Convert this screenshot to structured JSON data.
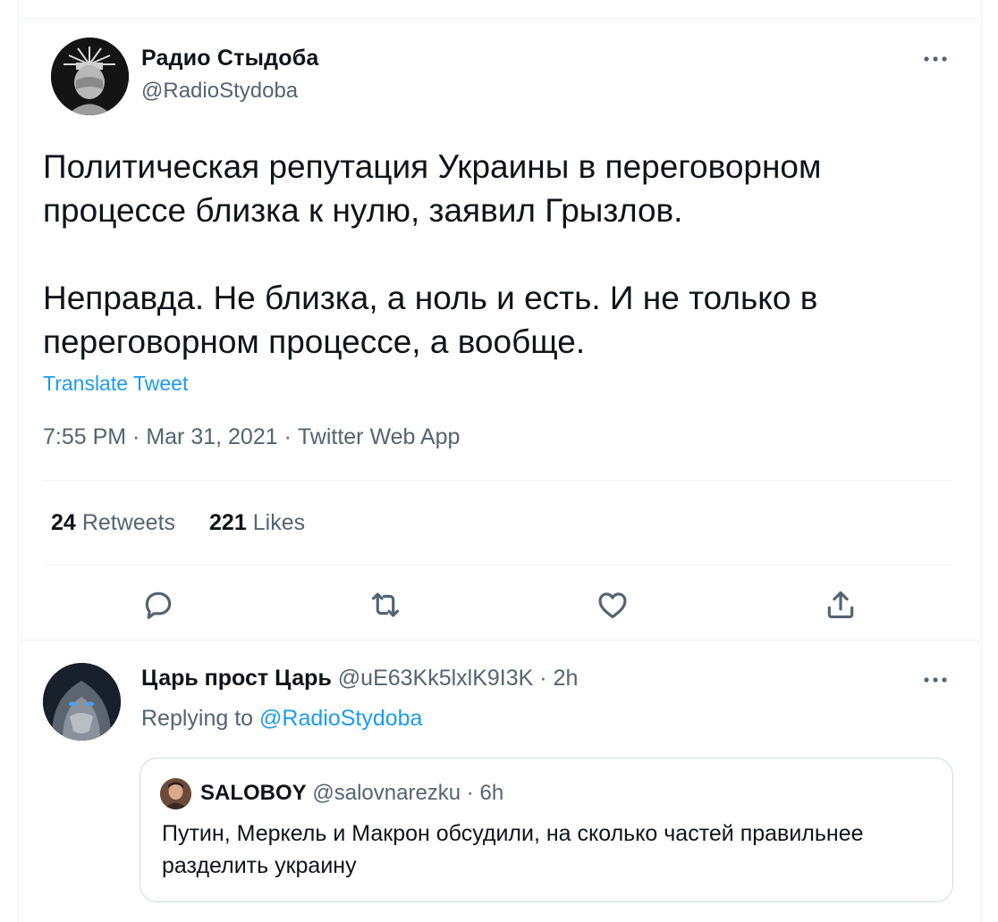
{
  "tweet": {
    "author_name": "Радио Стыдоба",
    "author_handle": "@RadioStydoba",
    "text_lines": [
      "Политическая репутация Украины в переговорном процессе близка к нулю, заявил Грызлов.",
      "Неправда. Не близка, а ноль и есть. И не только в переговорном процессе, а вообще."
    ],
    "translate_label": "Translate Tweet",
    "time": "7:55 PM",
    "date": "Mar 31, 2021",
    "source": "Twitter Web App",
    "retweets_count": "24",
    "retweets_label": "Retweets",
    "likes_count": "221",
    "likes_label": "Likes"
  },
  "icons": {
    "more": "more-icon",
    "reply": "reply-icon",
    "retweet": "retweet-icon",
    "like": "like-icon",
    "share": "share-icon"
  },
  "reply": {
    "author_name": "Царь прост Царь",
    "author_handle": "@uE63Kk5lxlK9I3K",
    "time": "2h",
    "replying_prefix": "Replying to",
    "replying_to": "@RadioStydoba",
    "quote": {
      "author_name": "SALOBOY",
      "author_handle": "@salovnarezku",
      "time": "6h",
      "text": "Путин, Меркель и Макрон обсудили, на сколько частей правильнее разделить украину"
    }
  },
  "colors": {
    "accent": "#1d9bf0",
    "text": "#0f1419",
    "secondary": "#536471",
    "border": "#eff3f4"
  }
}
